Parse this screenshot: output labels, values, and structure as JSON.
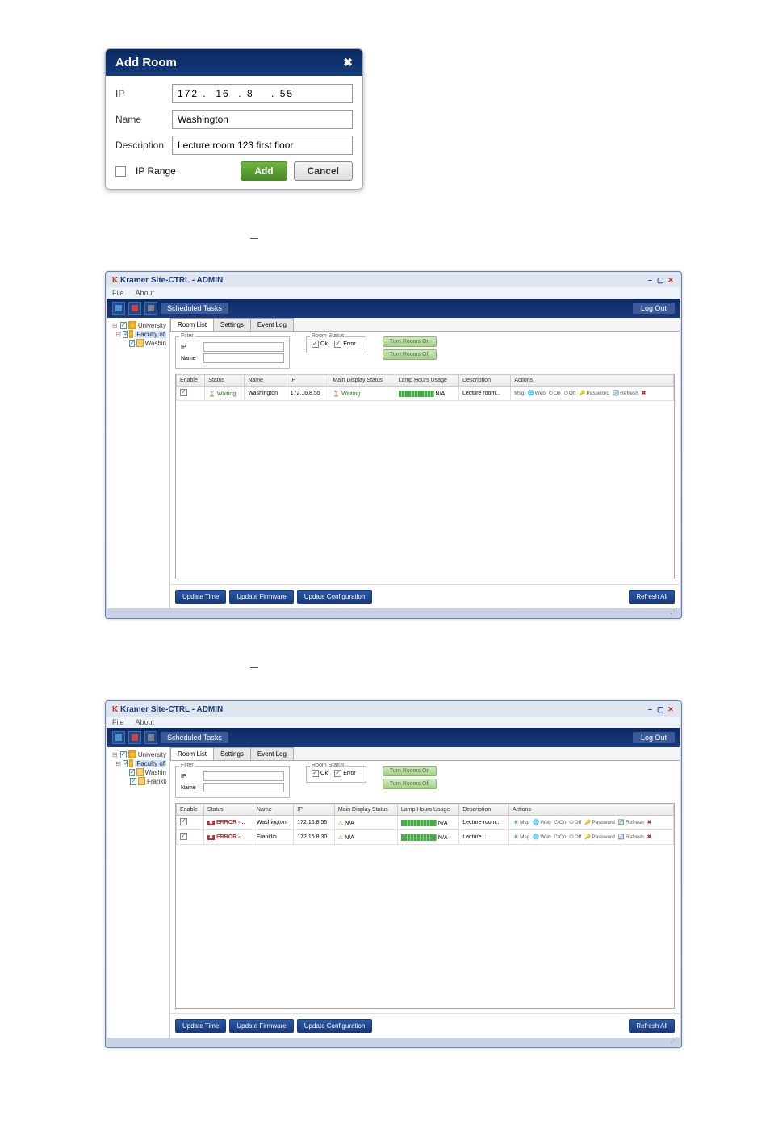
{
  "addRoomDialog": {
    "title": "Add Room",
    "labels": {
      "ip": "IP",
      "name": "Name",
      "description": "Description",
      "ipRange": "IP Range"
    },
    "values": {
      "ip": "172 .  16  . 8    . 55",
      "name": "Washington",
      "description": "Lecture room 123 first floor"
    },
    "buttons": {
      "add": "Add",
      "cancel": "Cancel"
    }
  },
  "adminWindow": {
    "title": "Kramer Site-CTRL - ADMIN",
    "menu": {
      "file": "File",
      "about": "About"
    },
    "toolbar": {
      "scheduledTasks": "Scheduled Tasks",
      "logout": "Log Out"
    },
    "tabs": {
      "roomList": "Room List",
      "settings": "Settings",
      "eventLog": "Event Log"
    },
    "filterLegend": "Filter",
    "filter": {
      "ip": "IP",
      "name": "Name"
    },
    "roomStatusLegend": "Room Status",
    "statusChecks": {
      "ok": "Ok",
      "error": "Error"
    },
    "turnButtons": {
      "on": "Turn Rooms On",
      "off": "Turn Rooms Off"
    },
    "columns": [
      "Enable",
      "Status",
      "Name",
      "IP",
      "Main Display Status",
      "Lamp Hours Usage",
      "Description",
      "Actions"
    ],
    "actions": {
      "msg": "Msg",
      "web": "Web",
      "on": "On",
      "off": "Off",
      "password": "Password",
      "refresh": "Refresh"
    },
    "footer": {
      "updateTime": "Update Time",
      "updateFirmware": "Update Firmware",
      "updateConfig": "Update Configuration",
      "refreshAll": "Refresh All"
    },
    "lampNA": "N/A"
  },
  "tree1": [
    {
      "indent": 0,
      "expand": "⊟",
      "label": "University",
      "icon": "home"
    },
    {
      "indent": 1,
      "expand": "⊟",
      "label": "Faculty of",
      "icon": "home",
      "selected": true
    },
    {
      "indent": 2,
      "expand": "",
      "label": "Washin",
      "icon": "folder"
    }
  ],
  "rows1": [
    {
      "status": "Waiting",
      "statusClass": "waiting",
      "name": "Washington",
      "ip": "172.16.8.55",
      "display": "Waiting",
      "displayClass": "waiting",
      "desc": "Lecture room...",
      "msgIcon": false
    }
  ],
  "tree2": [
    {
      "indent": 0,
      "expand": "⊟",
      "label": "University",
      "icon": "home"
    },
    {
      "indent": 1,
      "expand": "⊟",
      "label": "Faculty of",
      "icon": "home",
      "selected": true
    },
    {
      "indent": 2,
      "expand": "",
      "label": "Washin",
      "icon": "folder"
    },
    {
      "indent": 2,
      "expand": "",
      "label": "Frankli",
      "icon": "folder"
    }
  ],
  "rows2": [
    {
      "status": "ERROR -...",
      "statusClass": "error",
      "name": "Washington",
      "ip": "172.16.8.55",
      "display": "N/A",
      "displayClass": "warn",
      "desc": "Lecture room...",
      "msgIcon": true
    },
    {
      "status": "ERROR -...",
      "statusClass": "error",
      "name": "Franklin",
      "ip": "172.16.8.30",
      "display": "N/A",
      "displayClass": "warn",
      "desc": "Lecture...",
      "msgIcon": true
    }
  ]
}
